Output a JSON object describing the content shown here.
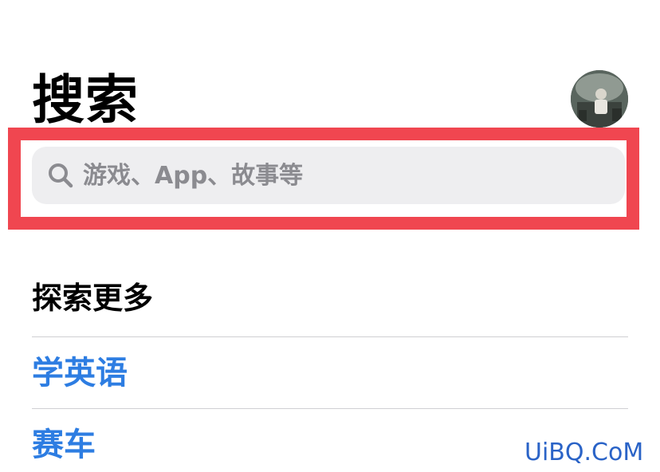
{
  "header": {
    "title": "搜索"
  },
  "avatar": {
    "icon": "user-avatar"
  },
  "search": {
    "placeholder": "游戏、App、故事等",
    "value": "",
    "icon": "search-icon"
  },
  "explore": {
    "section_title": "探索更多",
    "items": [
      {
        "label": "学英语"
      },
      {
        "label": "赛车"
      }
    ]
  },
  "watermark": {
    "text": "UiBQ.CoM"
  },
  "colors": {
    "highlight_border": "#f04650",
    "link": "#2d7de2",
    "search_bg": "#eeeef0",
    "placeholder": "#8b8b90"
  }
}
